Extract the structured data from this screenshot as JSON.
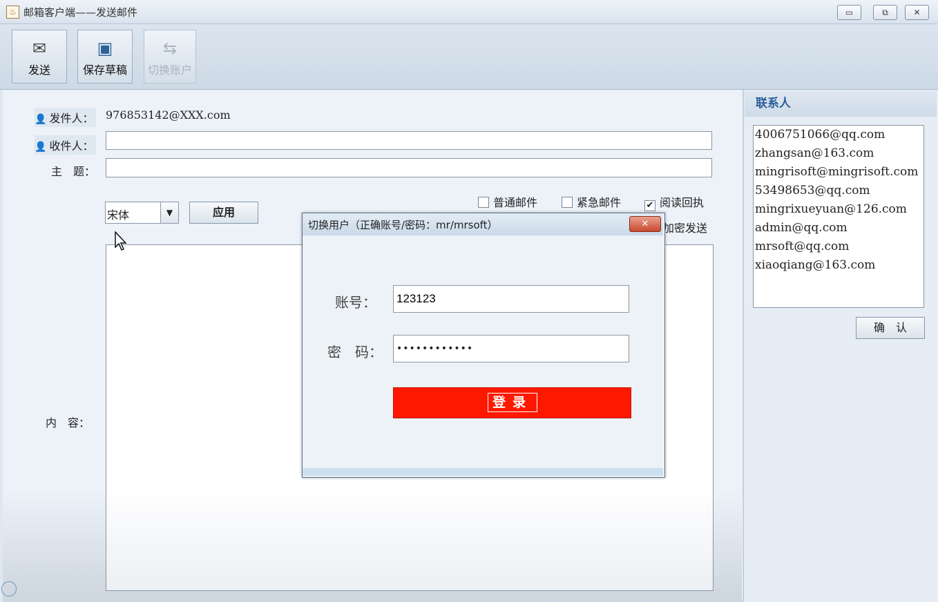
{
  "window": {
    "title": "邮箱客户端——发送邮件",
    "controls": {
      "minimize": "▭",
      "maximize": "⧉",
      "close": "✕"
    }
  },
  "toolbar": {
    "send": {
      "label": "发送",
      "icon": "envelope-icon"
    },
    "save_draft": {
      "label": "保存草稿",
      "icon": "floppy-disk-icon"
    },
    "switch_account": {
      "label": "切换账户",
      "icon": "user-switch-icon"
    }
  },
  "compose": {
    "sender_label": "发件人：",
    "sender_value": "976853142@XXX.com",
    "recipient_label": "收件人：",
    "recipient_value": "",
    "subject_label": "主　题：",
    "subject_value": "",
    "font_select_value": "宋体",
    "apply_button": "应用",
    "options": {
      "normal": {
        "label": "普通邮件",
        "checked": false
      },
      "urgent": {
        "label": "紧急邮件",
        "checked": false
      },
      "read_receipt": {
        "label": "阅读回执",
        "checked": true
      },
      "encrypt_partial": "加密发送"
    },
    "content_label": "内　容："
  },
  "contacts": {
    "title": "联系人",
    "items": [
      "4006751066@qq.com",
      "zhangsan@163.com",
      "mingrisoft@mingrisoft.com",
      "53498653@qq.com",
      "mingrixueyuan@126.com",
      "admin@qq.com",
      "mrsoft@qq.com",
      "xiaoqiang@163.com"
    ],
    "confirm_button": "确　认"
  },
  "dialog": {
    "title": "切换用户（正确账号/密码：mr/mrsoft）",
    "close": "✕",
    "account_label": "账号：",
    "account_value": "123123",
    "password_label": "密　码：",
    "password_value": "••••••••••••",
    "login_button": "登录"
  },
  "colors": {
    "login_button": "#ff1800",
    "contacts_title": "#2a5d99",
    "background": "#dfe8f1"
  }
}
